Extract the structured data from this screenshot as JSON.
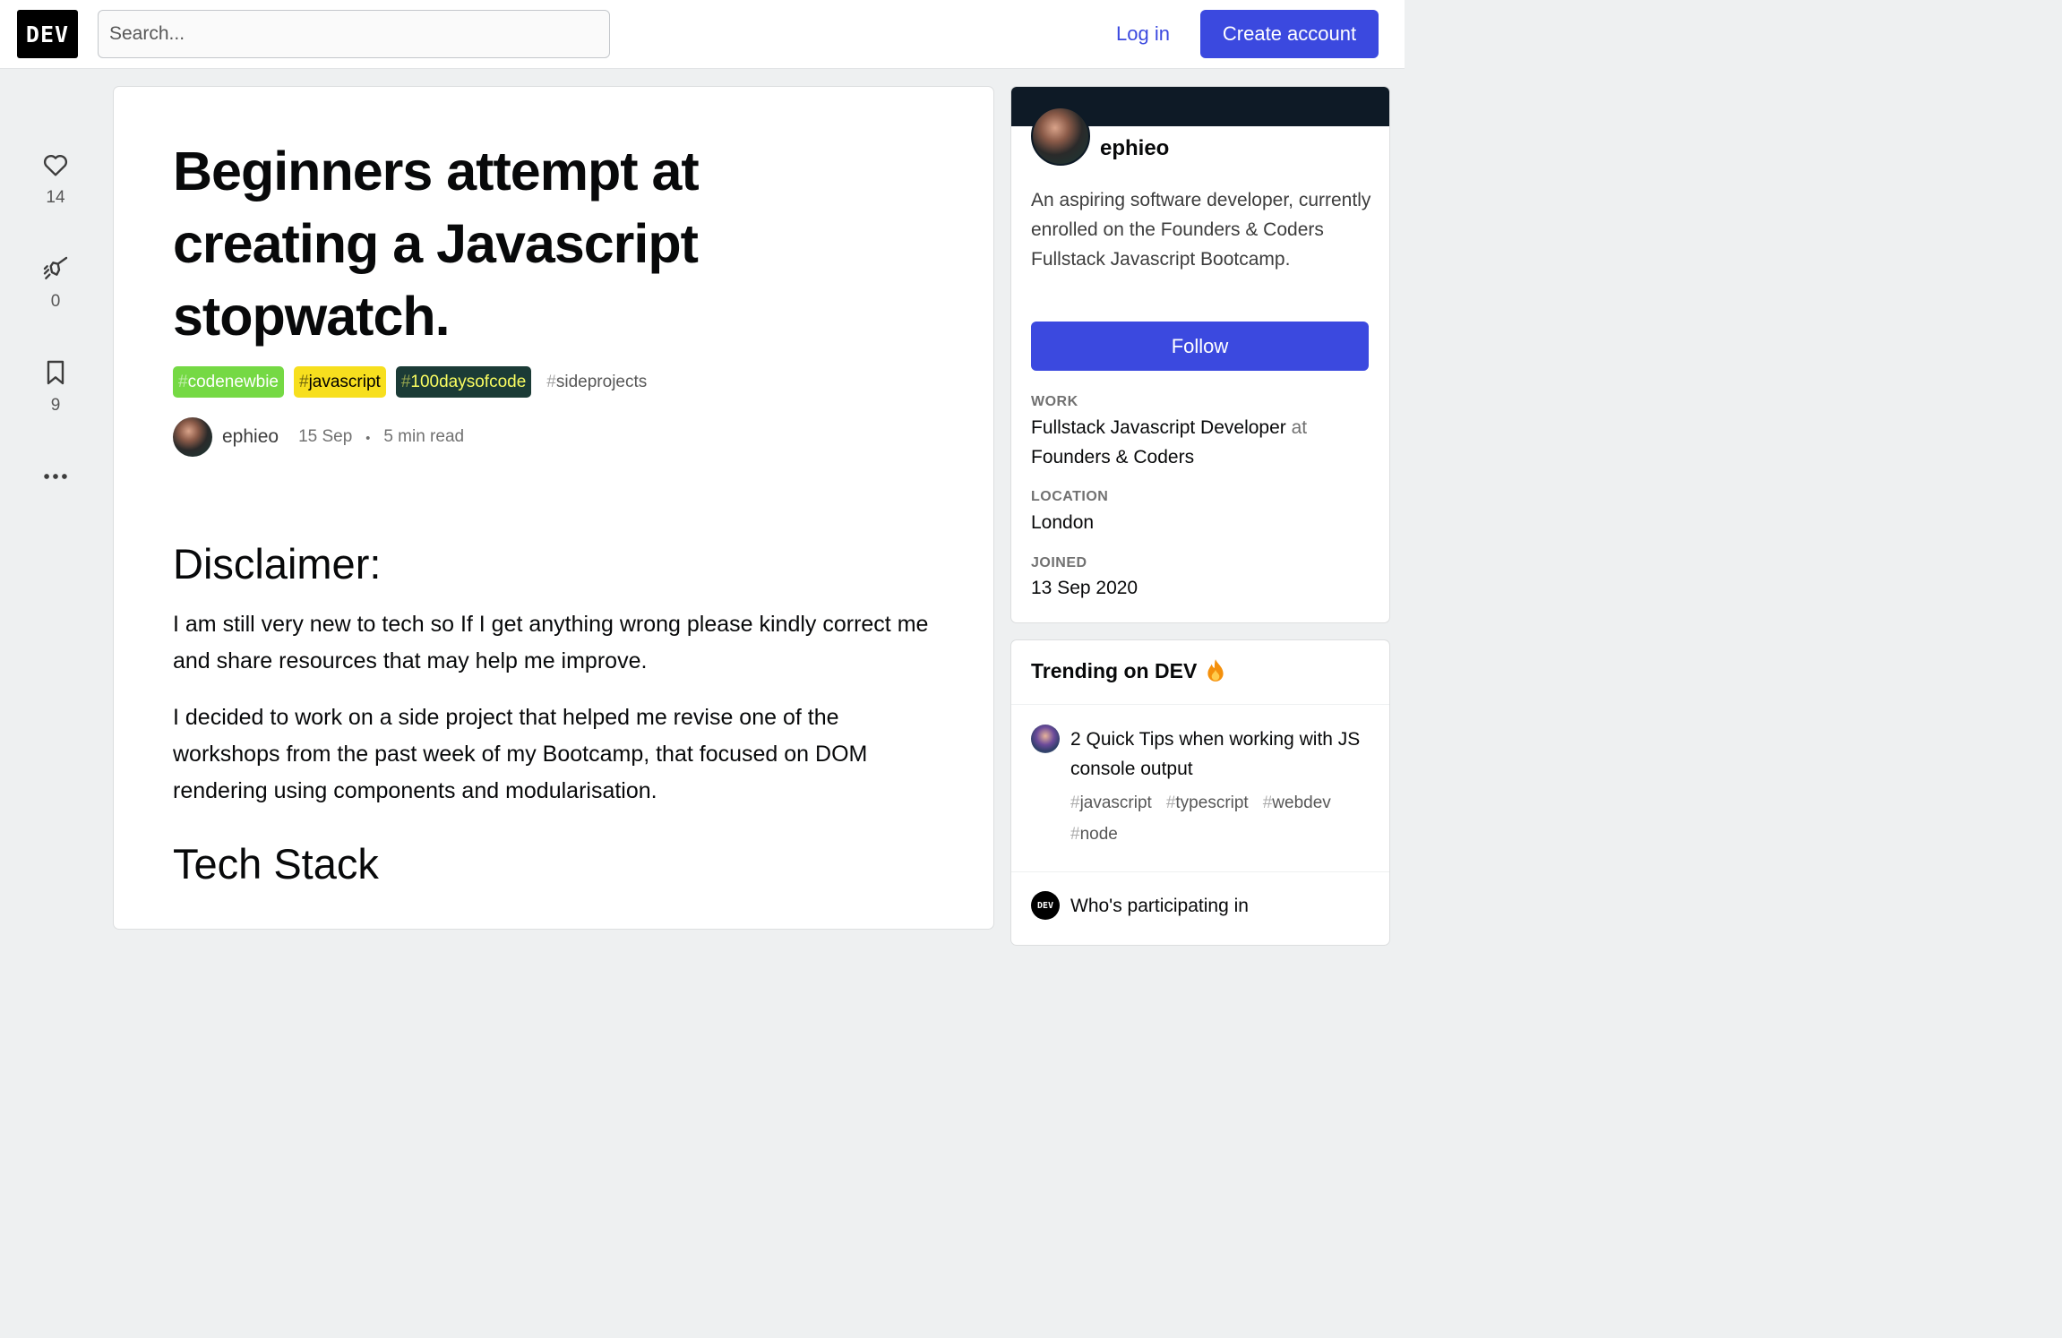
{
  "header": {
    "logo": "DEV",
    "search_placeholder": "Search...",
    "login_label": "Log in",
    "create_label": "Create account"
  },
  "reactions": {
    "hearts": "14",
    "unicorns": "0",
    "bookmarks": "9"
  },
  "article": {
    "title": "Beginners attempt at creating a Javascript stopwatch.",
    "tags": [
      {
        "hash": "#",
        "name": "codenewbie",
        "color": "#75d944"
      },
      {
        "hash": "#",
        "name": "javascript",
        "color": "#f7df1e"
      },
      {
        "hash": "#",
        "name": "100daysofcode",
        "color": "#1b3b36"
      },
      {
        "hash": "#",
        "name": "sideprojects",
        "color": "transparent"
      }
    ],
    "author": "ephieo",
    "date": "15 Sep",
    "dot": "・",
    "read_time": "5 min read",
    "heading1": "Disclaimer:",
    "para1": "I am still very new to tech so If I get anything wrong please kindly correct me and share resources that may help me improve.",
    "para2": "I decided to work on a side project that helped me revise one of the workshops from the past week of my Bootcamp, that focused on DOM rendering using components and modularisation.",
    "heading2": "Tech Stack"
  },
  "profile": {
    "name": "ephieo",
    "bio": "An aspiring software developer, currently enrolled on the Founders & Coders Fullstack Javascript Bootcamp.",
    "follow_label": "Follow",
    "work_label": "WORK",
    "work_title": "Fullstack Javascript Developer",
    "work_at": "at",
    "work_company": "Founders & Coders",
    "location_label": "LOCATION",
    "location": "London",
    "joined_label": "JOINED",
    "joined": "13 Sep 2020"
  },
  "trending": {
    "heading": "Trending on DEV",
    "items": [
      {
        "title": "2 Quick Tips when working with JS console output",
        "tags": [
          {
            "hash": "#",
            "name": "javascript"
          },
          {
            "hash": "#",
            "name": "typescript"
          },
          {
            "hash": "#",
            "name": "webdev"
          },
          {
            "hash": "#",
            "name": "node"
          }
        ]
      },
      {
        "title": "Who's participating in",
        "avatar_text": "DEV"
      }
    ]
  }
}
